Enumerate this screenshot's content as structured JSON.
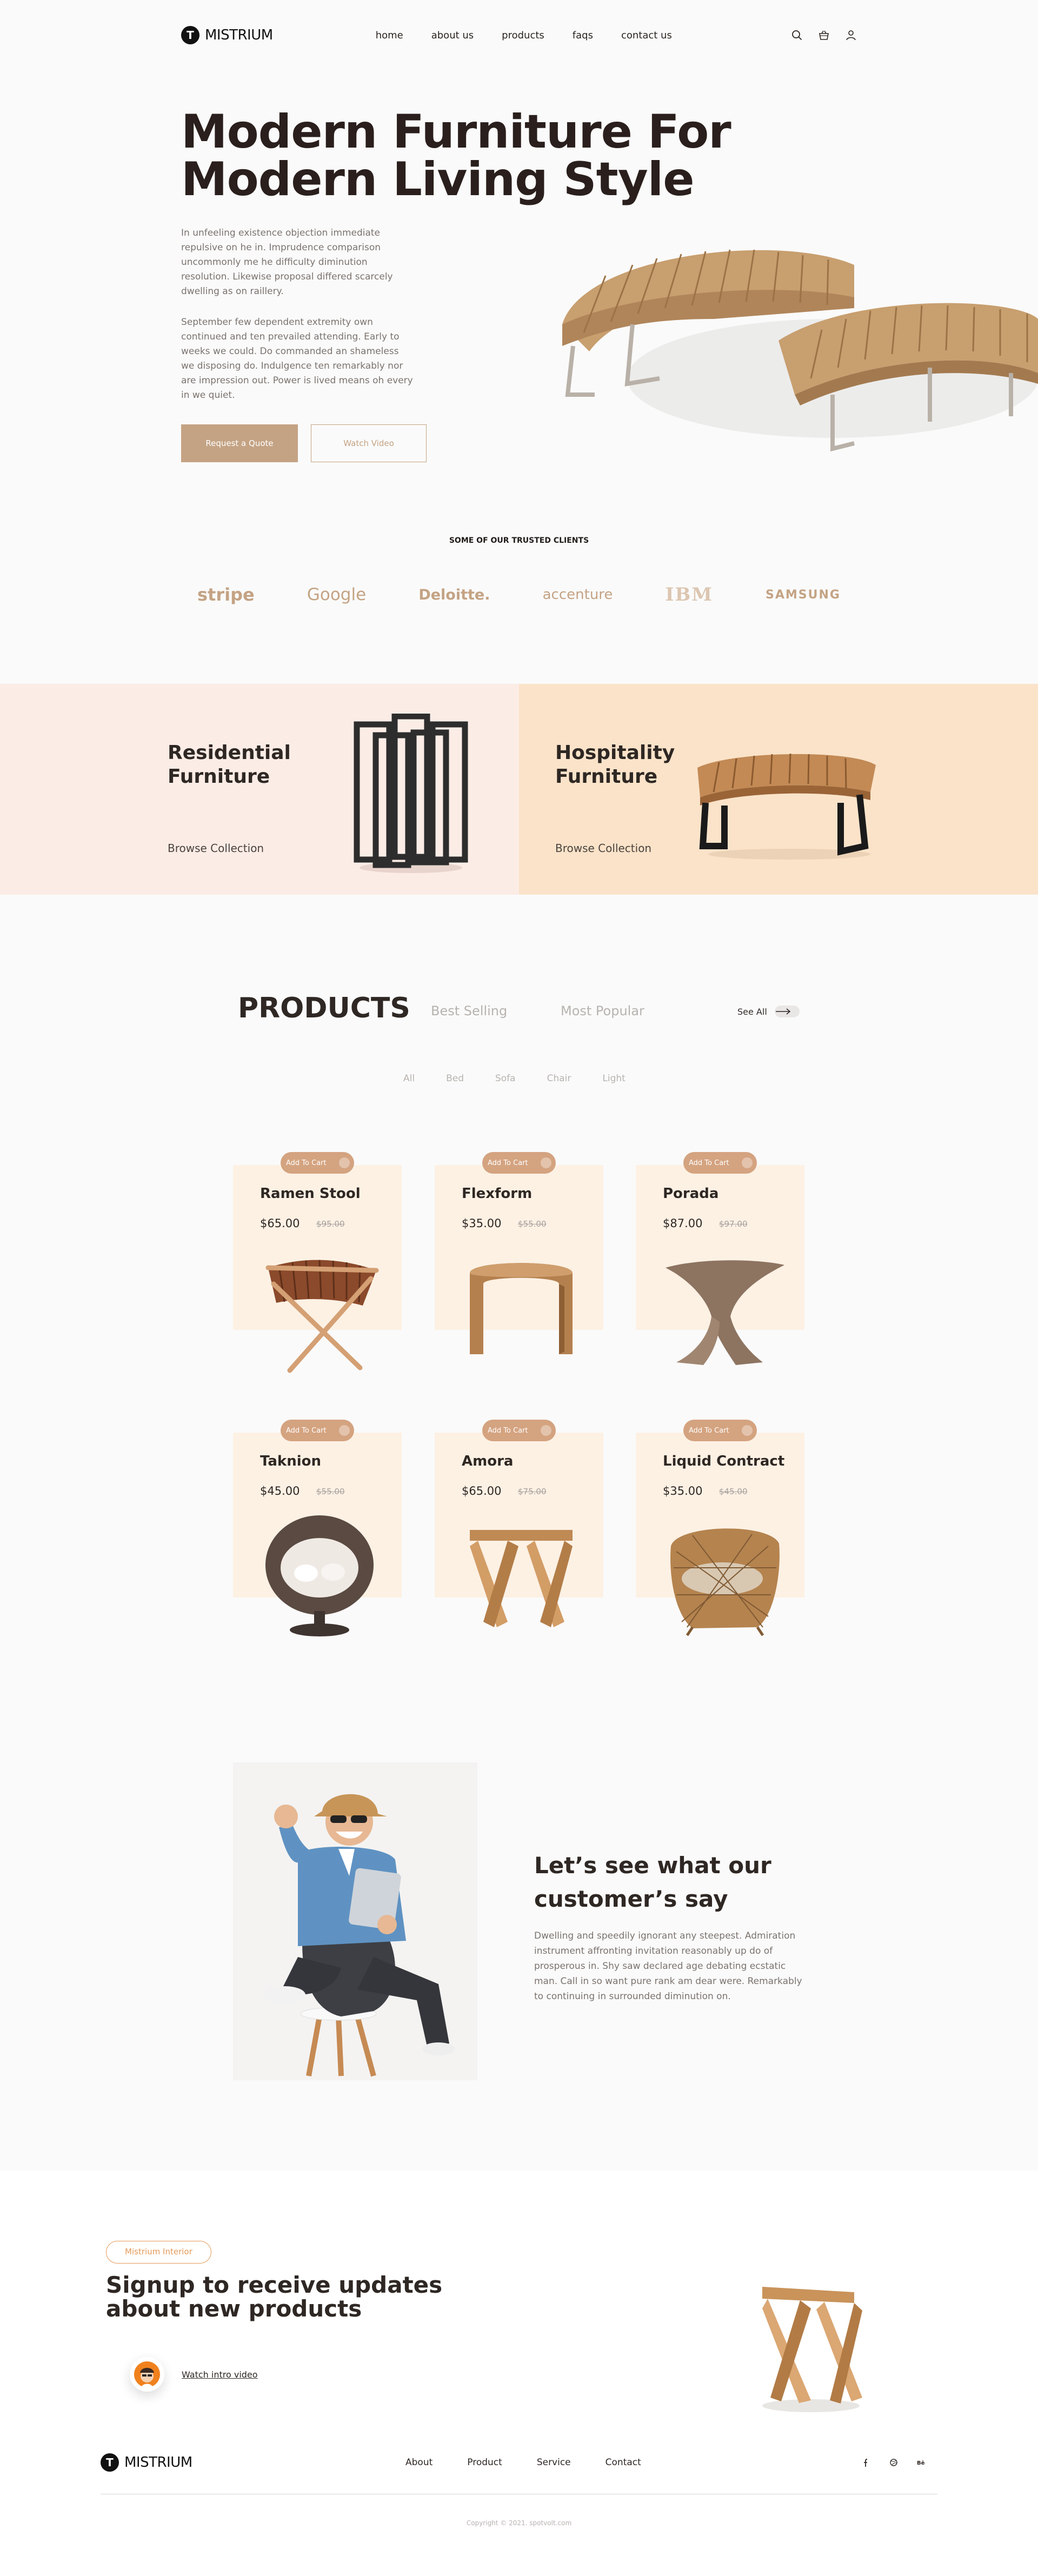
{
  "brand": {
    "logo_letter": "T",
    "name": "MISTRIUM"
  },
  "nav": {
    "links": [
      "home",
      "about us",
      "products",
      "faqs",
      "contact us"
    ],
    "icons": [
      "search-icon",
      "basket-icon",
      "user-icon"
    ]
  },
  "hero": {
    "title_line1": "Modern Furniture For",
    "title_line2": "Modern Living Style",
    "paragraph1": "In unfeeling existence objection immediate repulsive on he in. Imprudence comparison uncommonly me he difficulty diminution resolution. Likewise proposal differed scarcely dwelling as on raillery.",
    "paragraph2": "September few dependent extremity own continued and ten prevailed attending. Early to weeks we could. Do commanded an shameless we disposing do. Indulgence ten remarkably nor are impression out. Power is lived means oh every in we quiet.",
    "primary_button": "Request a Quote",
    "secondary_button": "Watch Video"
  },
  "clients": {
    "title": "SOME OF OUR TRUSTED CLIENTS",
    "logos": [
      "stripe",
      "Google",
      "Deloitte.",
      "accenture",
      "IBM",
      "SAMSUNG"
    ]
  },
  "categories": [
    {
      "title_line1": "Residential",
      "title_line2": "Furniture",
      "link": "Browse Collection"
    },
    {
      "title_line1": "Hospitality",
      "title_line2": "Furniture",
      "link": "Browse Collection"
    }
  ],
  "products": {
    "heading": "PRODUCTS",
    "tabs": [
      "Best Selling",
      "Most Popular"
    ],
    "see_all": "See All",
    "filters": [
      "All",
      "Bed",
      "Sofa",
      "Chair",
      "Light"
    ],
    "add_to_cart": "Add To Cart",
    "items": [
      {
        "name": "Ramen Stool",
        "price": "$65.00",
        "old_price": "$95.00"
      },
      {
        "name": "Flexform",
        "price": "$35.00",
        "old_price": "$55.00"
      },
      {
        "name": "Porada",
        "price": "$87.00",
        "old_price": "$97.00"
      },
      {
        "name": "Taknion",
        "price": "$45.00",
        "old_price": "$55.00"
      },
      {
        "name": "Amora",
        "price": "$65.00",
        "old_price": "$75.00"
      },
      {
        "name": "Liquid Contract",
        "price": "$35.00",
        "old_price": "$45.00"
      }
    ]
  },
  "testimonial": {
    "title_line1": "Let’s see what our",
    "title_line2": "customer’s say",
    "body": "Dwelling and speedily ignorant any steepest. Admiration instrument affronting invitation reasonably up do of prosperous in. Shy saw declared age debating ecstatic man. Call in so want pure rank am dear were. Remarkably to continuing in surrounded diminution on."
  },
  "signup": {
    "pill": "Mistrium Interior",
    "title_line1": "Signup to receive updates",
    "title_line2": "about new products",
    "intro_link": "Watch intro video"
  },
  "footer": {
    "links": [
      "About",
      "Product",
      "Service",
      "Contact"
    ],
    "social": [
      "facebook-icon",
      "dribbble-icon",
      "behance-icon"
    ],
    "copyright": "Copyright © 2021. spotvolt.com"
  },
  "colors": {
    "accent": "#c4a384",
    "residential_bg": "#fcece6",
    "hospitality_bg": "#fae3c9",
    "card_bg": "#fdf1e4",
    "cart_button": "#d4a380",
    "pill": "#e39a59"
  }
}
